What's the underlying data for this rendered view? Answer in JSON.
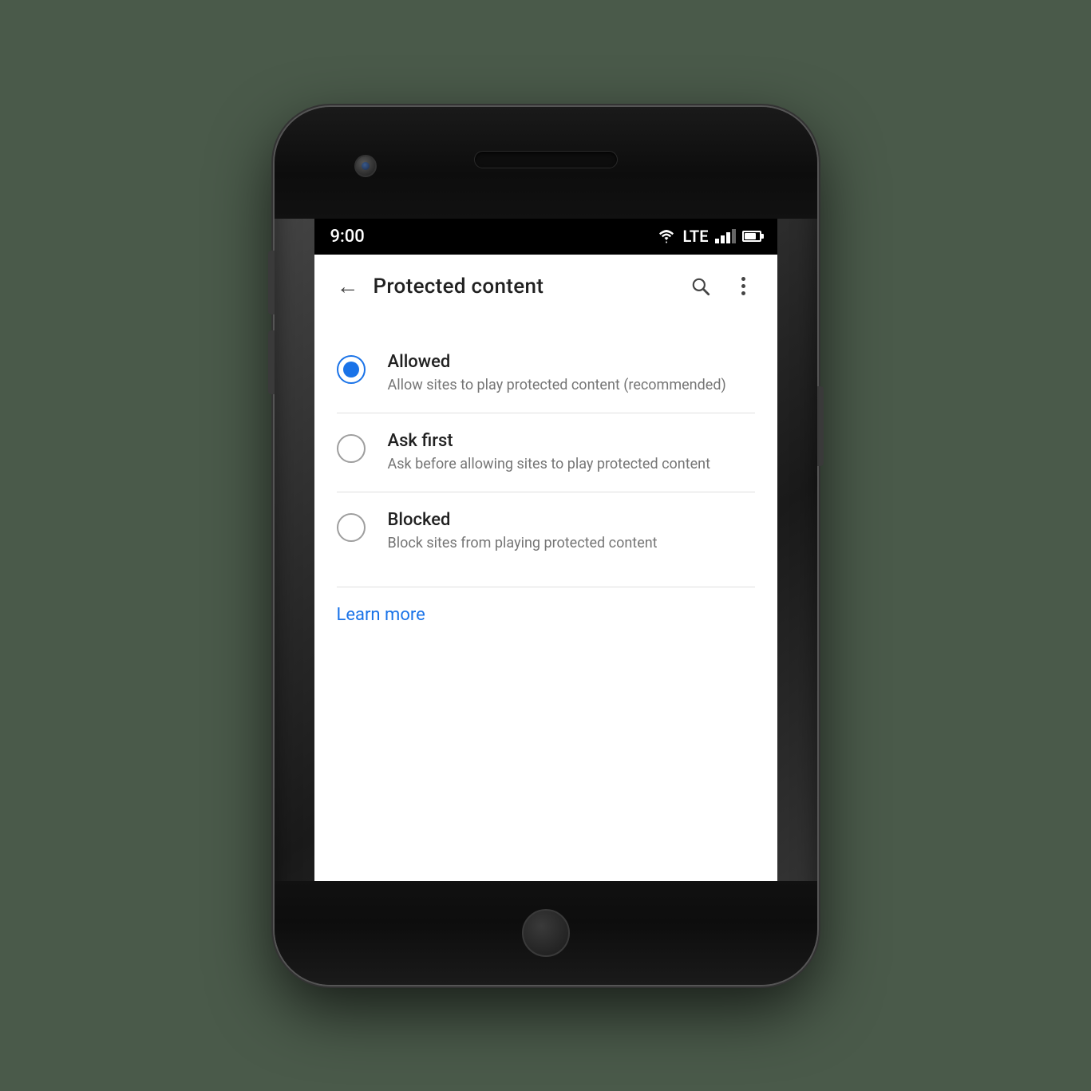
{
  "statusBar": {
    "time": "9:00",
    "lte": "LTE"
  },
  "appBar": {
    "title": "Protected content",
    "backLabel": "←"
  },
  "options": [
    {
      "id": "allowed",
      "title": "Allowed",
      "description": "Allow sites to play protected content (recommended)",
      "selected": true
    },
    {
      "id": "ask-first",
      "title": "Ask first",
      "description": "Ask before allowing sites to play protected content",
      "selected": false
    },
    {
      "id": "blocked",
      "title": "Blocked",
      "description": "Block sites from playing protected content",
      "selected": false
    }
  ],
  "learnMore": "Learn more",
  "icons": {
    "search": "🔍",
    "back": "←"
  }
}
